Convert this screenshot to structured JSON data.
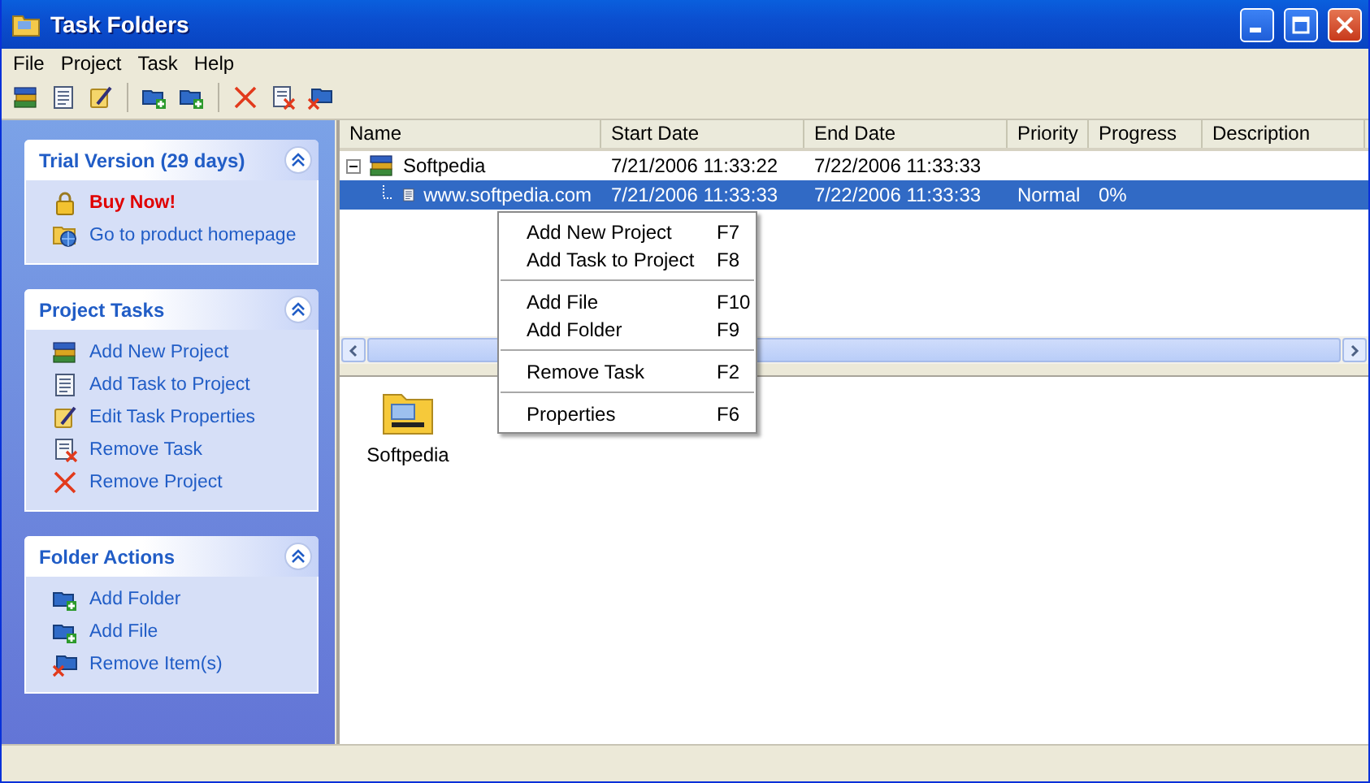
{
  "window": {
    "title": "Task Folders"
  },
  "menu_bar": [
    "File",
    "Project",
    "Task",
    "Help"
  ],
  "sidebar": {
    "panels": [
      {
        "title": "Trial Version (29 days)",
        "expanded": true,
        "items": [
          {
            "label": "Buy Now!",
            "kind": "promo"
          },
          {
            "label": "Go to product homepage",
            "kind": "link"
          }
        ]
      },
      {
        "title": "Project Tasks",
        "expanded": true,
        "items": [
          {
            "label": "Add New Project",
            "kind": "link"
          },
          {
            "label": "Add Task to Project",
            "kind": "link"
          },
          {
            "label": "Edit Task Properties",
            "kind": "link"
          },
          {
            "label": "Remove Task",
            "kind": "link"
          },
          {
            "label": "Remove Project",
            "kind": "link"
          }
        ]
      },
      {
        "title": "Folder Actions",
        "expanded": true,
        "items": [
          {
            "label": "Add Folder",
            "kind": "link"
          },
          {
            "label": "Add File",
            "kind": "link"
          },
          {
            "label": "Remove Item(s)",
            "kind": "link"
          }
        ]
      }
    ]
  },
  "table": {
    "columns": [
      "Name",
      "Start Date",
      "End Date",
      "Priority",
      "Progress",
      "Description"
    ],
    "rows": [
      {
        "cells": [
          "Softpedia",
          "7/21/2006 11:33:22",
          "7/22/2006 11:33:33",
          "",
          "",
          ""
        ],
        "expanded": true,
        "selected": false,
        "children": [
          {
            "cells": [
              "www.softpedia.com",
              "7/21/2006 11:33:33",
              "7/22/2006 11:33:33",
              "Normal",
              "0%",
              ""
            ],
            "selected": true
          }
        ]
      }
    ]
  },
  "context_menu": {
    "groups": [
      [
        {
          "label": "Add New Project",
          "shortcut": "F7"
        },
        {
          "label": "Add Task to Project",
          "shortcut": "F8"
        }
      ],
      [
        {
          "label": "Add File",
          "shortcut": "F10"
        },
        {
          "label": "Add Folder",
          "shortcut": "F9"
        }
      ],
      [
        {
          "label": "Remove Task",
          "shortcut": "F2"
        }
      ],
      [
        {
          "label": "Properties",
          "shortcut": "F6"
        }
      ]
    ]
  },
  "folder_view": {
    "items": [
      {
        "label": "Softpedia"
      }
    ]
  }
}
